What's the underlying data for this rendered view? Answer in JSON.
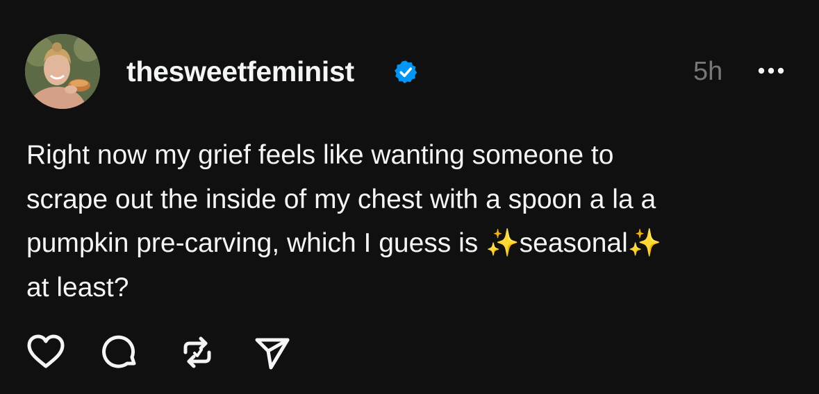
{
  "post": {
    "username": "thesweetfeminist",
    "verified": true,
    "time": "5h",
    "text": "Right now my grief feels like wanting someone to\nscrape out the inside of my chest with a spoon a la a\npumpkin pre-carving, which I guess is ✨seasonal✨\nat least?"
  },
  "icons": {
    "verified": "verified-badge-icon",
    "more": "more-options-icon",
    "like": "heart-icon",
    "reply": "comment-bubble-icon",
    "repost": "repost-icon",
    "share": "send-icon"
  },
  "colors": {
    "background": "#101010",
    "text": "#f3f5f7",
    "muted": "#777777",
    "verified": "#0095f6"
  }
}
